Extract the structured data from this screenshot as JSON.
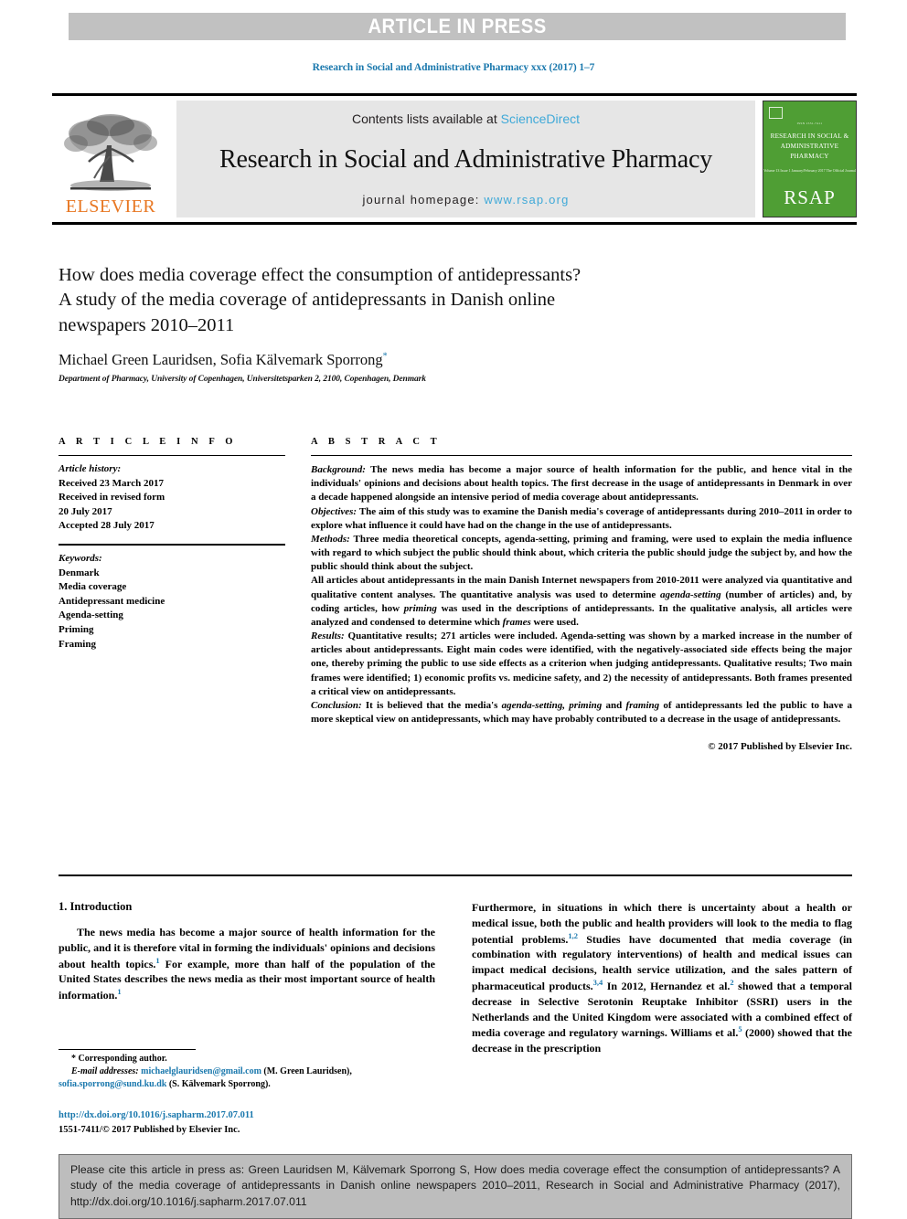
{
  "banner": {
    "text": "ARTICLE IN PRESS"
  },
  "running_head": "Research in Social and Administrative Pharmacy xxx (2017) 1–7",
  "masthead": {
    "contents_prefix": "Contents lists available at ",
    "sciencedirect": "ScienceDirect",
    "journal_title": "Research in Social and Administrative Pharmacy",
    "homepage_prefix": "journal homepage: ",
    "homepage_url": "www.rsap.org",
    "publisher_wordmark": "ELSEVIER",
    "cover": {
      "tiny_top": "ISSN 1551-7411",
      "name": "RESEARCH IN SOCIAL &\nADMINISTRATIVE PHARMACY",
      "sub": "Volume 13  Issue 1\nJanuary/February 2017\nThe Official Journal",
      "acronym": "RSAP"
    },
    "colors": {
      "banner_bg": "#c1c1c1",
      "link_blue": "#1a78ad",
      "sd_blue": "#3fa9d8",
      "elsevier_orange": "#e87722",
      "cover_green": "#4f9e34"
    }
  },
  "title": {
    "line1": "How does media coverage effect the consumption of antidepressants?",
    "line2": "A study of the media coverage of antidepressants in Danish online",
    "line3": "newspapers 2010–2011"
  },
  "authors": {
    "names": "Michael Green Lauridsen, Sofia Kälvemark Sporrong",
    "corresponding_marker": "*",
    "affiliation": "Department of Pharmacy, University of Copenhagen, Universitetsparken 2, 2100, Copenhagen, Denmark"
  },
  "article_info": {
    "heading": "A R T I C L E   I N F O",
    "history_label": "Article history:",
    "history": [
      "Received 23 March 2017",
      "Received in revised form",
      "20 July 2017",
      "Accepted 28 July 2017"
    ],
    "keywords_label": "Keywords:",
    "keywords": [
      "Denmark",
      "Media coverage",
      "Antidepressant medicine",
      "Agenda-setting",
      "Priming",
      "Framing"
    ]
  },
  "abstract": {
    "heading": "A B S T R A C T",
    "background_label": "Background:",
    "background": " The news media has become a major source of health information for the public, and hence vital in the individuals' opinions and decisions about health topics. The first decrease in the usage of antidepressants in Denmark in over a decade happened alongside an intensive period of media coverage about antidepressants.",
    "objectives_label": "Objectives:",
    "objectives": " The aim of this study was to examine the Danish media's coverage of antidepressants during 2010–2011 in order to explore what influence it could have had on the change in the use of antidepressants.",
    "methods_label": "Methods:",
    "methods_p1": " Three media theoretical concepts, agenda-setting, priming and framing, were used to explain the media influence with regard to which subject the public should think about, which criteria the public should judge the subject by, and how the public should think about the subject.",
    "methods_p2_a": "All articles about antidepressants in the main Danish Internet newspapers from 2010-2011 were analyzed via quantitative and qualitative content analyses. The quantitative analysis was used to determine ",
    "methods_p2_i1": "agenda-setting",
    "methods_p2_b": " (number of articles) and, by coding articles, how ",
    "methods_p2_i2": "priming",
    "methods_p2_c": " was used in the descriptions of antidepressants. In the qualitative analysis, all articles were analyzed and condensed to determine which ",
    "methods_p2_i3": "frames",
    "methods_p2_d": " were used.",
    "results_label": "Results:",
    "results": " Quantitative results; 271 articles were included. Agenda-setting was shown by a marked increase in the number of articles about antidepressants. Eight main codes were identified, with the negatively-associated side effects being the major one, thereby priming the public to use side effects as a criterion when judging antidepressants. Qualitative results; Two main frames were identified; 1) economic profits vs. medicine safety, and 2) the necessity of antidepressants. Both frames presented a critical view on antidepressants.",
    "conclusion_label": "Conclusion:",
    "conclusion_a": " It is believed that the media's ",
    "conclusion_i1": "agenda-setting, priming",
    "conclusion_b": " and ",
    "conclusion_i2": "framing",
    "conclusion_c": " of antidepressants led the public to have a more skeptical view on antidepressants, which may have probably contributed to a decrease in the usage of antidepressants.",
    "copyright": "© 2017 Published by Elsevier Inc."
  },
  "body": {
    "section_heading": "1. Introduction",
    "left_para_1": "The news media has become a major source of health information for the public, and it is therefore vital in forming the individuals' opinions and decisions about health topics.",
    "left_ref_1": "1",
    "left_para_1b": " For example, more than half of the population of the United States describes the news media as their most important source of health information.",
    "left_ref_2": "1",
    "right_para_a": "Furthermore, in situations in which there is uncertainty about a health or medical issue, both the public and health providers will look to the media to flag potential problems.",
    "right_ref_1": "1,2",
    "right_para_b": " Studies have documented that media coverage (in combination with regulatory interventions) of health and medical issues can impact medical decisions, health service utilization, and the sales pattern of pharmaceutical products.",
    "right_ref_2": "3,4",
    "right_para_c": " In 2012, Hernandez et al.",
    "right_ref_3": "2",
    "right_para_d": " showed that a temporal decrease in Selective Serotonin Reuptake Inhibitor (SSRI) users in the Netherlands and the United Kingdom were associated with a combined effect of media coverage and regulatory warnings. Williams et al.",
    "right_ref_4": "5",
    "right_para_e": " (2000) showed that the decrease in the prescription"
  },
  "footnotes": {
    "corresponding_marker": "*",
    "corresponding_text": " Corresponding author.",
    "email_label": "E-mail addresses:",
    "email_1": "michaelglauridsen@gmail.com",
    "email_1_owner": " (M. Green Lauridsen), ",
    "email_2": "sofia.sporrong@sund.ku.dk",
    "email_2_owner": " (S. Kälvemark Sporrong)."
  },
  "doi": {
    "link": "http://dx.doi.org/10.1016/j.sapharm.2017.07.011",
    "issn_line": "1551-7411/© 2017 Published by Elsevier Inc."
  },
  "cite_box": {
    "text": "Please cite this article in press as: Green Lauridsen M, Kälvemark Sporrong S, How does media coverage effect the consumption of antidepressants? A study of the media coverage of antidepressants in Danish online newspapers 2010–2011, Research in Social and Administrative Pharmacy (2017), http://dx.doi.org/10.1016/j.sapharm.2017.07.011"
  }
}
